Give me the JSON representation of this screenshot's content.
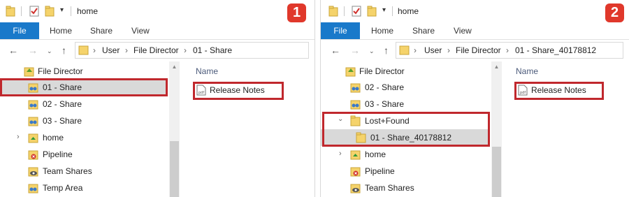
{
  "panels": [
    {
      "badge": "1",
      "title": "home",
      "ribbon_tabs": [
        "File",
        "Home",
        "Share",
        "View"
      ],
      "breadcrumb": [
        "User",
        "File Director",
        "01 - Share"
      ],
      "tree": [
        {
          "label": "File Director",
          "icon": "file-director-icon"
        },
        {
          "label": "01 - Share",
          "icon": "shared-folder-icon",
          "selected": true,
          "highlighted": true
        },
        {
          "label": "02 - Share",
          "icon": "shared-folder-icon"
        },
        {
          "label": "03 - Share",
          "icon": "shared-folder-icon"
        },
        {
          "label": "home",
          "icon": "home-folder-icon",
          "collapsed": true
        },
        {
          "label": "Pipeline",
          "icon": "pipeline-icon"
        },
        {
          "label": "Team Shares",
          "icon": "team-shares-icon"
        },
        {
          "label": "Temp Area",
          "icon": "shared-folder-icon"
        }
      ],
      "column_header": "Name",
      "files": [
        {
          "label": "Release Notes",
          "icon": "pdf-file-icon",
          "highlighted": true
        }
      ]
    },
    {
      "badge": "2",
      "title": "home",
      "ribbon_tabs": [
        "File",
        "Home",
        "Share",
        "View"
      ],
      "breadcrumb": [
        "User",
        "File Director",
        "01 - Share_40178812"
      ],
      "tree": [
        {
          "label": "File Director",
          "icon": "file-director-icon"
        },
        {
          "label": "02 - Share",
          "icon": "shared-folder-icon"
        },
        {
          "label": "03 - Share",
          "icon": "shared-folder-icon"
        },
        {
          "label": "Lost+Found",
          "icon": "folder-icon",
          "expanded": true,
          "highlighted": true
        },
        {
          "label": "01 - Share_40178812",
          "icon": "folder-icon",
          "selected": true,
          "highlighted": true
        },
        {
          "label": "home",
          "icon": "home-folder-icon",
          "collapsed": true
        },
        {
          "label": "Pipeline",
          "icon": "pipeline-icon"
        },
        {
          "label": "Team Shares",
          "icon": "team-shares-icon"
        }
      ],
      "column_header": "Name",
      "files": [
        {
          "label": "Release Notes",
          "icon": "pdf-file-icon",
          "highlighted": true
        }
      ]
    }
  ],
  "colors": {
    "accent_blue": "#1979ca",
    "highlight_red": "#c0282d",
    "badge_red": "#e0382b",
    "selection_grey": "#d9d9d9",
    "folder_yellow": "#f5d36b"
  }
}
